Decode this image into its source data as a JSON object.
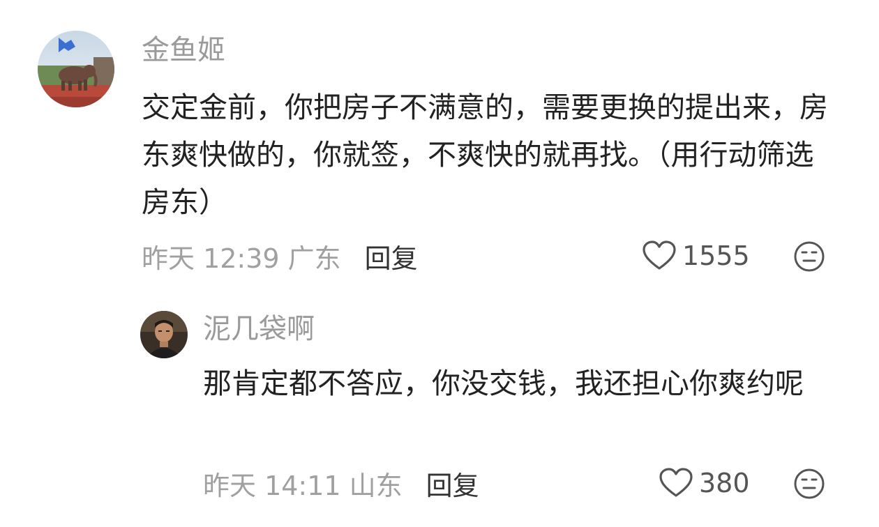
{
  "comments": [
    {
      "username": "金鱼姬",
      "text": "交定金前，你把房子不满意的，需要更换的提出来，房东爽快做的，你就签，不爽快的就再找。（用行动筛选房东）",
      "time": "昨天 12:39",
      "region": "广东",
      "reply_label": "回复",
      "likes": "1555",
      "icons": {
        "like": "heart-outline-icon",
        "emoji": "neutral-face-icon"
      }
    }
  ],
  "replies": [
    {
      "username": "泥几袋啊",
      "text": "那肯定都不答应，你没交钱，我还担心你爽约呢",
      "time": "昨天 14:11",
      "region": "山东",
      "reply_label": "回复",
      "likes": "380",
      "icons": {
        "like": "heart-outline-icon",
        "emoji": "neutral-face-icon"
      }
    }
  ],
  "colors": {
    "username": "#9a9a9a",
    "body_text": "#222222",
    "meta_text": "#a0a0a0",
    "icon_stroke": "#555555"
  }
}
